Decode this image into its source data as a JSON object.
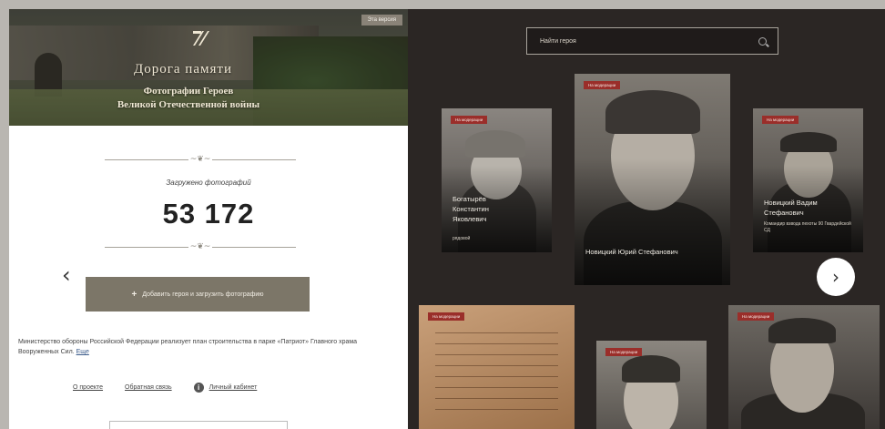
{
  "hero": {
    "title": "Дорога памяти",
    "subtitle_line1": "Фотографии Героев",
    "subtitle_line2": "Великой Отечественной войны",
    "badge": "Эта версия"
  },
  "stats": {
    "label": "Загружено фотографий",
    "value": "53 172"
  },
  "actions": {
    "add_hero_label": "Добавить героя и загрузить фотографию"
  },
  "notice": {
    "text": "Министерство обороны Российской Федерации реализует план строительства в парке «Патриот» Главного храма Вооруженных Сил.",
    "more": "Еще"
  },
  "footer_links": {
    "about": "О проекте",
    "feedback": "Обратная связь",
    "cabinet": "Личный кабинет"
  },
  "search": {
    "placeholder": "Найти героя"
  },
  "cards": [
    {
      "tag": "На модерации",
      "name": "Богатырёв Константин Яковлевич",
      "sub": "рядовой"
    },
    {
      "tag": "На модерации",
      "name": "Новицкий Юрий Стефанович",
      "sub": ""
    },
    {
      "tag": "На модерации",
      "name": "Новицкий Вадим Стефанович",
      "sub": "Командир взвода пехоты 90 Гвардейской СД"
    },
    {
      "tag": "На модерации",
      "name": "",
      "sub": ""
    },
    {
      "tag": "На модерации",
      "name": "",
      "sub": ""
    },
    {
      "tag": "На модерации",
      "name": "",
      "sub": ""
    }
  ],
  "icons": {
    "prev": "chevron-left-icon",
    "next": "chevron-right-icon",
    "search": "search-icon",
    "info": "info-icon",
    "emblem": "emblem-icon"
  },
  "colors": {
    "right_bg": "#2b2624",
    "tag_red": "#9a2e2a",
    "button_bg": "#7c7668"
  }
}
